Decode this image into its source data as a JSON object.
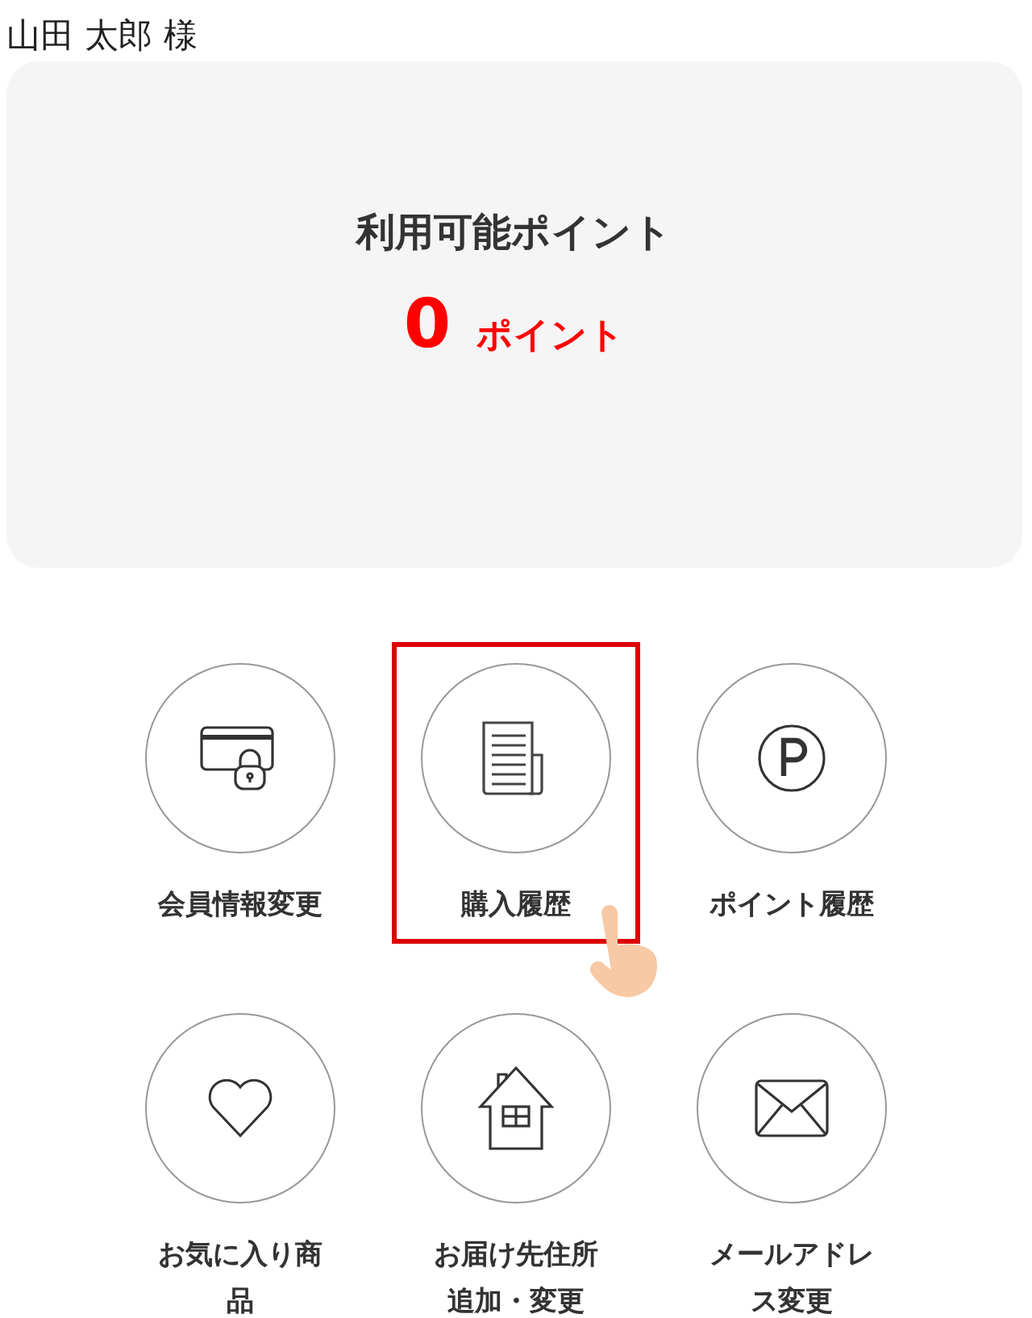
{
  "user_name": "山田 太郎 様",
  "points_card": {
    "title": "利用可能ポイント",
    "value": "0",
    "unit": "ポイント"
  },
  "menu": [
    {
      "label": "会員情報変更",
      "kind": "card",
      "selected": false
    },
    {
      "label": "購入履歴",
      "kind": "receipt",
      "selected": true
    },
    {
      "label": "ポイント履歴",
      "kind": "point",
      "selected": false
    },
    {
      "label": "お気に入り商品",
      "kind": "heart",
      "selected": false
    },
    {
      "label": "お届け先住所追加・変更",
      "kind": "house",
      "selected": false
    },
    {
      "label": "メールアドレス変更",
      "kind": "mail",
      "selected": false
    }
  ]
}
